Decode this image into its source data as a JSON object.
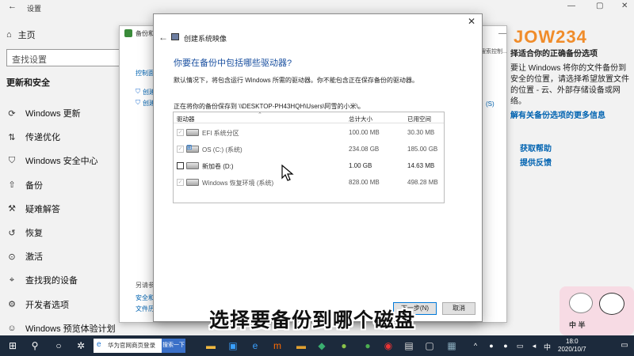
{
  "settings": {
    "title": "设置",
    "home_label": "主页",
    "search_placeholder": "查找设置",
    "section_title": "更新和安全",
    "nav_items": [
      {
        "label": "Windows 更新",
        "icon": "sync-icon"
      },
      {
        "label": "传递优化",
        "icon": "delivery-icon"
      },
      {
        "label": "Windows 安全中心",
        "icon": "shield-icon"
      },
      {
        "label": "备份",
        "icon": "backup-icon"
      },
      {
        "label": "疑难解答",
        "icon": "wrench-icon"
      },
      {
        "label": "恢复",
        "icon": "recovery-icon"
      },
      {
        "label": "激活",
        "icon": "activation-icon"
      },
      {
        "label": "查找我的设备",
        "icon": "locate-icon"
      },
      {
        "label": "开发者选项",
        "icon": "developer-icon"
      },
      {
        "label": "Windows 预览体验计划",
        "icon": "insider-icon"
      }
    ],
    "right_panel": {
      "title": "择适合你的正确备份选项",
      "body": "要让 Windows 将你的文件备份到安全的位置，请选择希望放置文件的位置 - 云、外部存储设备或网络。",
      "link": "解有关备份选项的更多信息",
      "help_link": "获取帮助",
      "feedback_link": "提供反馈"
    },
    "logo_text": "JOW234"
  },
  "control_panel": {
    "title": "备份和还",
    "home_link": "控制面",
    "links": [
      "创建",
      "创建"
    ],
    "see_also": "另请参",
    "see_also_items": [
      "安全和",
      "文件历"
    ],
    "search_fragment": "搜索控制...",
    "right_text": "(S)"
  },
  "wizard": {
    "title": "创建系统映像",
    "heading": "你要在备份中包括哪些驱动器?",
    "description": "默认情况下，将包含运行 Windows 所需的驱动器。你不能包含正在保存备份的驱动器。",
    "save_path": "正在将你的备份保存到 \\\\DESKTOP-PH43HQH\\Users\\阿雪的小米\\。",
    "columns": {
      "drive": "驱动器",
      "total": "总计大小",
      "used": "已用空间"
    },
    "drives": [
      {
        "name": "EFI 系统分区",
        "total": "100.00 MB",
        "used": "30.30 MB",
        "checked": true,
        "enabled": false,
        "icon": "drive-icon"
      },
      {
        "name": "OS (C:) (系统)",
        "total": "234.08 GB",
        "used": "185.00 GB",
        "checked": true,
        "enabled": false,
        "icon": "windows-drive-icon"
      },
      {
        "name": "新加卷 (D:)",
        "total": "1.00 GB",
        "used": "14.63 MB",
        "checked": false,
        "enabled": true,
        "icon": "drive-icon"
      },
      {
        "name": "Windows 恢复环境 (系统)",
        "total": "828.00 MB",
        "used": "498.28 MB",
        "checked": true,
        "enabled": false,
        "icon": "drive-icon"
      }
    ],
    "next_label": "下一步(N)",
    "cancel_label": "取消"
  },
  "subtitle": "选择要备份到哪个磁盘",
  "mascot_text": "中 半",
  "taskbar": {
    "search_text": "华为官网商页登录",
    "search_button": "搜索一下",
    "lang": "中",
    "time": "18:0",
    "date": "2020/10/7"
  }
}
